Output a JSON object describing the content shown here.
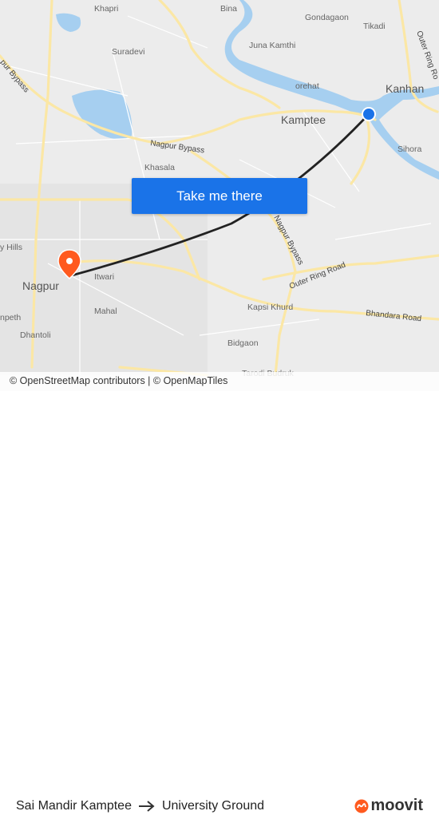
{
  "map": {
    "places": {
      "khapri": "Khapri",
      "bina": "Bina",
      "gondagaon": "Gondagaon",
      "tikadi": "Tikadi",
      "suradevi": "Suradevi",
      "juna_kamthi": "Juna Kamthi",
      "kanhan": "Kanhan",
      "orehat": "orehat",
      "kamptee": "Kamptee",
      "sihora": "Sihora",
      "khasala": "Khasala",
      "hills": "y Hills",
      "nagpur": "Nagpur",
      "itwari": "Itwari",
      "mahal": "Mahal",
      "dhantoli": "Dhantoli",
      "npeth": "npeth",
      "kapsi_khurd": "Kapsi Khurd",
      "bidgaon": "Bidgaon",
      "tarodi_budruk": "Tarodi Budruk"
    },
    "roads": {
      "pur_bypass": "pur Bypass",
      "nagpur_bypass_top": "Nagpur Bypass",
      "nagpur_bypass_diag": "Nagpur Bypass",
      "outer_ring_road": "Outer Ring Road",
      "outer_ring_ro_right": "Outer Ring Ro",
      "bhandara_road": "Bhandara Road"
    },
    "colors": {
      "land": "#ececec",
      "water": "#a6cff0",
      "road": "#fbe7a5",
      "route": "#222222",
      "origin": "#1a73e8",
      "destination": "#ff5a1f"
    }
  },
  "cta": {
    "label": "Take me there"
  },
  "attribution": {
    "text": "© OpenStreetMap contributors | © OpenMapTiles"
  },
  "route": {
    "from": "Sai Mandir Kamptee",
    "to": "University Ground"
  },
  "brand": {
    "name": "moovit",
    "color": "#ff5a1f"
  }
}
